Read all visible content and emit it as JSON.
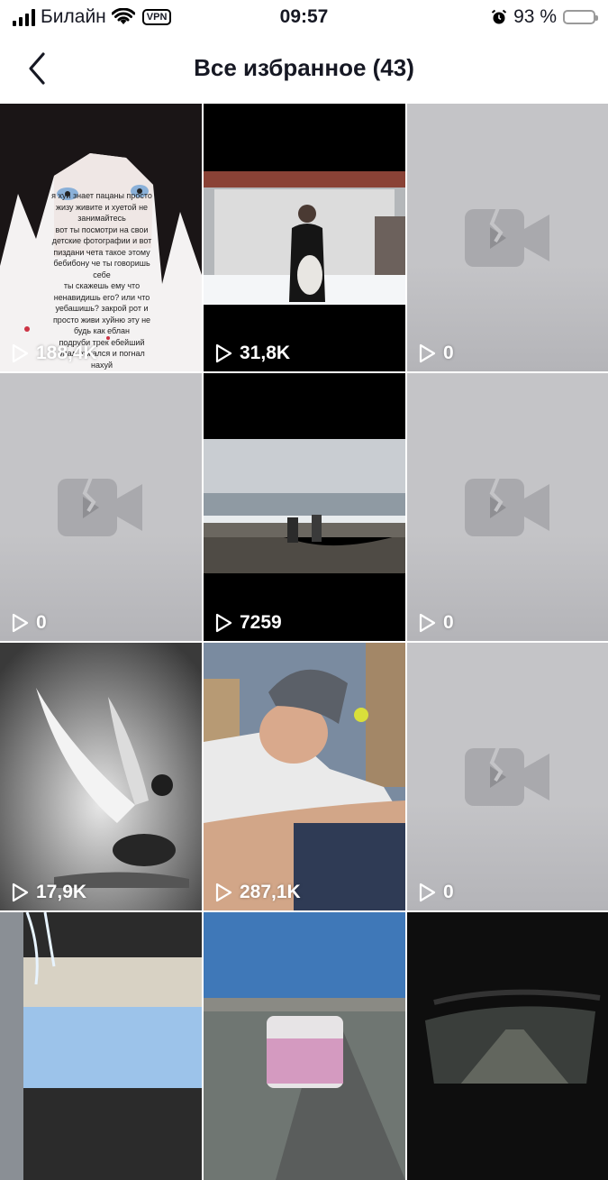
{
  "status_bar": {
    "carrier": "Билайн",
    "vpn": "VPN",
    "time": "09:57",
    "battery": "93 %"
  },
  "nav": {
    "title": "Все избранное (43)"
  },
  "videos": [
    {
      "views": "188,4K",
      "overlay": "я хуй знает пацаны просто\nжизу живите и хуетой не\nзанимайтесь\nвот ты посмотри на свои\nдетские фотографии и вот\nпиздани чета такое этому\nбебибону че ты говоришь\nсебе\nты скажешь ему что\nненавидишь его? или что\nуебашишь? закрой рот и\nпросто живи хуйню эту не\nбудь как еблан\nподруби трек ебейший\nупал отжался и погнал\nнахуй"
    },
    {
      "views": "31,8K"
    },
    {
      "views": "0"
    },
    {
      "views": "0"
    },
    {
      "views": "7259"
    },
    {
      "views": "0"
    },
    {
      "views": "17,9K"
    },
    {
      "views": "287,1K"
    },
    {
      "views": "0"
    },
    {
      "views": ""
    },
    {
      "views": ""
    },
    {
      "views": ""
    }
  ]
}
